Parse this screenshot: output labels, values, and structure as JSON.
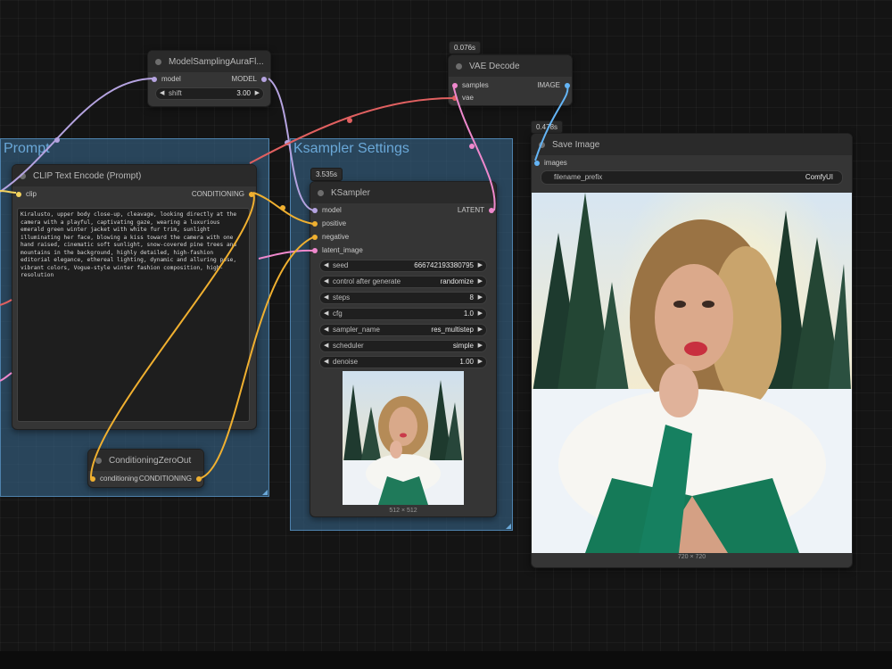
{
  "colors": {
    "model_link": "#b5a3e0",
    "vae_link": "#e06060",
    "conditioning_link": "#f0b030",
    "latent_link": "#ee88cc",
    "image_link": "#64b5f6",
    "clip_link": "#f4d35e"
  },
  "groups": {
    "prompt": {
      "title": "Prompt"
    },
    "ksampler_settings": {
      "title": "Ksampler Settings"
    }
  },
  "nodes": {
    "model_sampling": {
      "title": "ModelSamplingAuraFl...",
      "input_model": "model",
      "output_model": "MODEL",
      "shift": {
        "label": "shift",
        "value": "3.00"
      }
    },
    "vae_decode": {
      "badge": "0.076s",
      "title": "VAE Decode",
      "input_samples": "samples",
      "input_vae": "vae",
      "output_image": "IMAGE"
    },
    "clip_text_encode": {
      "title": "CLIP Text Encode (Prompt)",
      "input_clip": "clip",
      "output_conditioning": "CONDITIONING",
      "prompt_text": "Kiralusto, upper body close-up, cleavage, looking directly at the camera with a playful, captivating gaze, wearing a luxurious emerald green winter jacket with white fur trim, sunlight illuminating her face, blowing a kiss toward the camera with one hand raised, cinematic soft sunlight, snow-covered pine trees and mountains in the background, highly detailed, high-fashion editorial elegance, ethereal lighting, dynamic and alluring pose, vibrant colors, Vogue-style winter fashion composition, high-resolution"
    },
    "conditioning_zero_out": {
      "title": "ConditioningZeroOut",
      "input_conditioning": "conditioning",
      "output_conditioning": "CONDITIONING"
    },
    "ksampler": {
      "badge": "3.535s",
      "title": "KSampler",
      "input_model": "model",
      "input_positive": "positive",
      "input_negative": "negative",
      "input_latent": "latent_image",
      "output_latent": "LATENT",
      "widgets": [
        {
          "label": "seed",
          "value": "666742193380795"
        },
        {
          "label": "control after generate",
          "value": "randomize"
        },
        {
          "label": "steps",
          "value": "8"
        },
        {
          "label": "cfg",
          "value": "1.0"
        },
        {
          "label": "sampler_name",
          "value": "res_multistep"
        },
        {
          "label": "scheduler",
          "value": "simple"
        },
        {
          "label": "denoise",
          "value": "1.00"
        }
      ],
      "preview_caption": "512 × 512"
    },
    "save_image": {
      "badge": "0.478s",
      "title": "Save Image",
      "input_images": "images",
      "filename_prefix": {
        "label": "filename_prefix",
        "value": "ComfyUI"
      },
      "preview_caption": "720 × 720"
    }
  }
}
